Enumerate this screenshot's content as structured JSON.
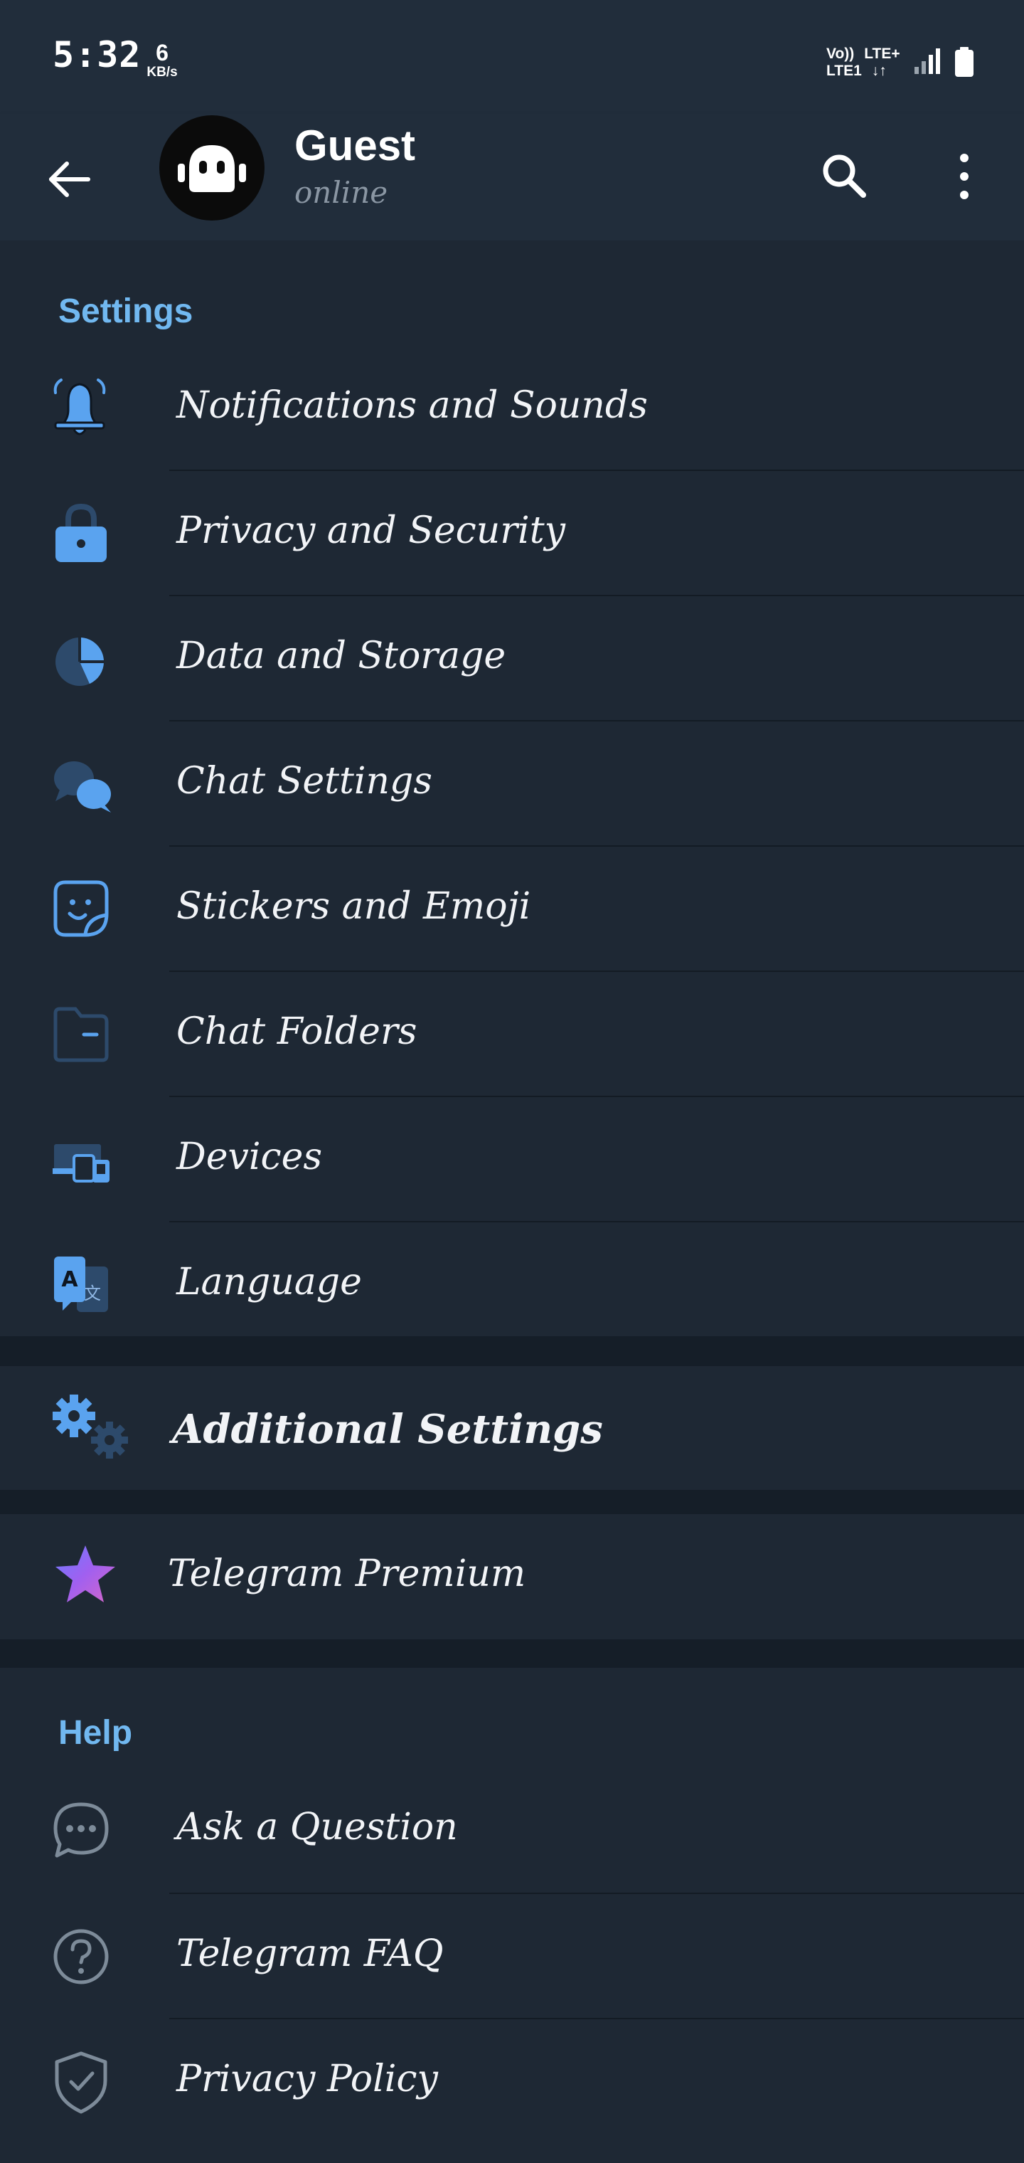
{
  "status_bar": {
    "time": "5:32",
    "speed_value": "6",
    "speed_unit": "KB/s",
    "net_line1_a": "Vo))",
    "net_line1_b": "LTE+",
    "net_line2_a": "LTE1",
    "net_line2_b": "↓↑"
  },
  "header": {
    "name": "Guest",
    "status": "online",
    "back_icon": "arrow-left-icon",
    "search_icon": "search-icon",
    "more_icon": "more-vertical-icon"
  },
  "settings": {
    "title": "Settings",
    "items": [
      {
        "label": "Notifications and Sounds",
        "icon": "bell-icon"
      },
      {
        "label": "Privacy and Security",
        "icon": "lock-icon"
      },
      {
        "label": "Data and Storage",
        "icon": "pie-chart-icon"
      },
      {
        "label": "Chat Settings",
        "icon": "chat-bubbles-icon"
      },
      {
        "label": "Stickers and Emoji",
        "icon": "sticker-icon"
      },
      {
        "label": "Chat Folders",
        "icon": "folder-icon"
      },
      {
        "label": "Devices",
        "icon": "devices-icon"
      },
      {
        "label": "Language",
        "icon": "translate-icon"
      }
    ]
  },
  "additional": {
    "label": "Additional Settings",
    "icon": "gears-icon"
  },
  "premium": {
    "label": "Telegram Premium",
    "icon": "star-icon"
  },
  "help": {
    "title": "Help",
    "items": [
      {
        "label": "Ask a Question",
        "icon": "chat-dots-icon"
      },
      {
        "label": "Telegram FAQ",
        "icon": "question-circle-icon"
      },
      {
        "label": "Privacy Policy",
        "icon": "shield-check-icon"
      }
    ]
  },
  "colors": {
    "background": "#1d2733",
    "header": "#212d3b",
    "accent": "#71b8f0",
    "icon_blue": "#5aa3ef"
  }
}
